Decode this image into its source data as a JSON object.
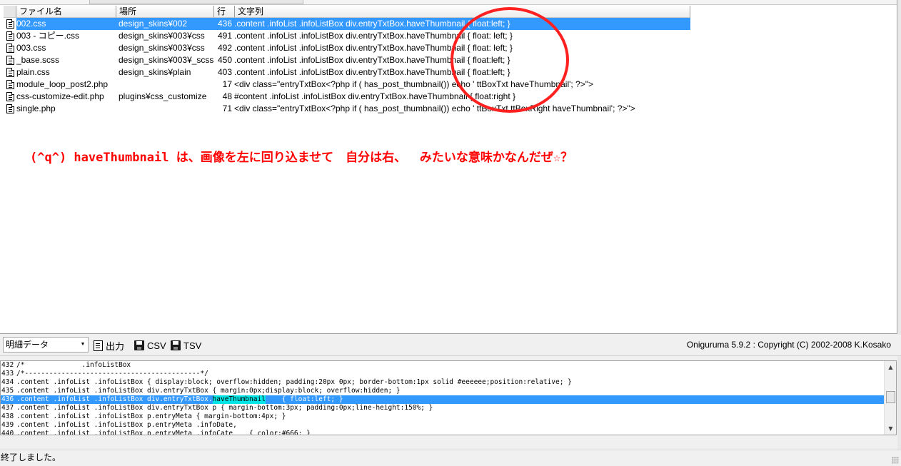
{
  "columns": {
    "file": "ファイル名",
    "path": "場所",
    "line": "行",
    "text": "文字列"
  },
  "rows": [
    {
      "file": "002.css",
      "path": "design_skins¥002",
      "line": "436",
      "text": ".content .infoList .infoListBox div.entryTxtBox.haveThumbnail    { float:left; }",
      "selected": true
    },
    {
      "file": "003 - コピー.css",
      "path": "design_skins¥003¥css",
      "line": "491",
      "text": ".content .infoList .infoListBox div.entryTxtBox.haveThumbnail { float: left; }"
    },
    {
      "file": "003.css",
      "path": "design_skins¥003¥css",
      "line": "492",
      "text": ".content .infoList .infoListBox div.entryTxtBox.haveThumbnail { float: left; }"
    },
    {
      "file": "_base.scss",
      "path": "design_skins¥003¥_scss",
      "line": "450",
      "text": ".content .infoList .infoListBox div.entryTxtBox.haveThumbnail    { float:left; }"
    },
    {
      "file": "plain.css",
      "path": "design_skins¥plain",
      "line": "403",
      "text": ".content .infoList .infoListBox div.entryTxtBox.haveThumbnail    { float:left; }"
    },
    {
      "file": "module_loop_post2.php",
      "path": "",
      "line": "17",
      "text": "    <div class=\"entryTxtBox<?php if ( has_post_thumbnail()) echo ' ttBoxTxt haveThumbnail'; ?>\">"
    },
    {
      "file": "css-customize-edit.php",
      "path": "plugins¥css_customize",
      "line": "48",
      "text": "#content .infoList .infoListBox div.entryTxtBox.haveThumbnail { float:right }"
    },
    {
      "file": "single.php",
      "path": "",
      "line": "71",
      "text": "        <div class=\"entryTxtBox<?php if ( has_post_thumbnail()) echo ' ttBoxTxt ttBoxRight haveThumbnail'; ?>\">"
    }
  ],
  "annotation": "(^q^) haveThumbnail は、画像を左に回り込ませて　自分は右、　 みたいな意味かなんだぜ☆？",
  "toolbar": {
    "view_select": "明細データ",
    "output_label": "出力",
    "csv_label": "CSV",
    "tsv_label": "TSV",
    "copyright": "Oniguruma 5.9.2 : Copyright (C) 2002-2008 K.Kosako"
  },
  "source_lines": [
    {
      "no": "432",
      "text": "/*              .infoListBox"
    },
    {
      "no": "433",
      "text": "/*-------------------------------------------*/"
    },
    {
      "no": "434",
      "text": ".content .infoList .infoListBox { display:block; overflow:hidden; padding:20px 0px; border-bottom:1px solid #eeeeee;position:relative; }"
    },
    {
      "no": "435",
      "text": ".content .infoList .infoListBox div.entryTxtBox { margin:0px;display:block; overflow:hidden; }"
    },
    {
      "no": "436",
      "pre": ".content .infoList .infoListBox div.entryTxtBox.",
      "hl": "haveThumbnail",
      "post": "    { float:left; }",
      "selected": true
    },
    {
      "no": "437",
      "text": ".content .infoList .infoListBox div.entryTxtBox p { margin-bottom:3px; padding:0px;line-height:150%; }"
    },
    {
      "no": "438",
      "text": ".content .infoList .infoListBox p.entryMeta { margin-bottom:4px; }"
    },
    {
      "no": "439",
      "text": ".content .infoList .infoListBox p.entryMeta .infoDate,"
    },
    {
      "no": "440",
      "text": ".content .infoList .infoListBox p.entryMeta .infoCate    { color:#666; }"
    }
  ],
  "status_text": "終了しました。",
  "colors": {
    "selection": "#3399ff",
    "highlight": "#00e5e5",
    "annotation": "#ff0000"
  }
}
